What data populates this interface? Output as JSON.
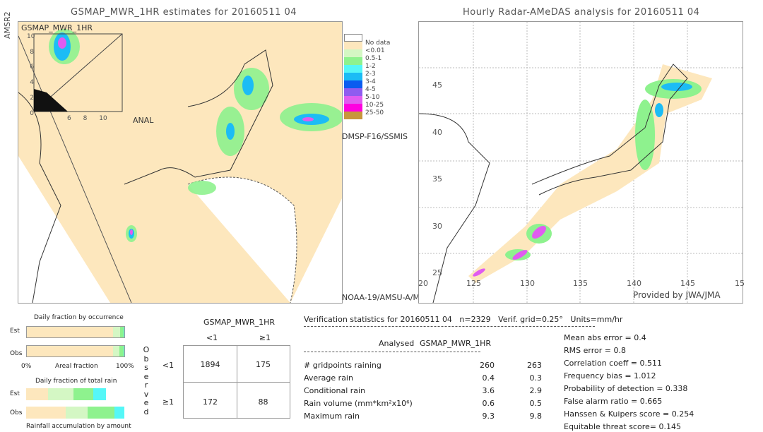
{
  "left_map": {
    "title": "GSMAP_MWR_1HR estimates for 20160511 04",
    "sensor_top": "AMSR2",
    "inset_label": "GSMAP_MWR_1HR",
    "inset_ticks": [
      "0",
      "2",
      "4",
      "6",
      "8",
      "10"
    ],
    "anal_label": "ANAL",
    "sensor_mid": "DMSP-F16/SSMIS",
    "sensor_bottom": "NOAA-19/AMSU-A/M"
  },
  "legend": [
    {
      "label": "No data",
      "color": "#ffffff"
    },
    {
      "label": "<0.01",
      "color": "#fde7bd"
    },
    {
      "label": "0.5-1",
      "color": "#d4f7c4"
    },
    {
      "label": "1-2",
      "color": "#8ef28e"
    },
    {
      "label": "2-3",
      "color": "#55f7f7"
    },
    {
      "label": "3-4",
      "color": "#1cbcf5"
    },
    {
      "label": "4-5",
      "color": "#0a5cf0"
    },
    {
      "label": "5-10",
      "color": "#8f5cf0"
    },
    {
      "label": "10-25",
      "color": "#e05cf0"
    },
    {
      "label": "25-50",
      "color": "#ff00e0"
    },
    {
      "label": "",
      "color": "#c8963c"
    }
  ],
  "right_map": {
    "title": "Hourly Radar-AMeDAS analysis for 20160511 04",
    "lat_ticks": [
      "45",
      "40",
      "35",
      "30",
      "25",
      "20"
    ],
    "lon_ticks": [
      "125",
      "130",
      "135",
      "140",
      "145",
      "15"
    ],
    "credit": "Provided by JWA/JMA"
  },
  "occurrence": {
    "title": "Daily fraction by occurrence",
    "est_label": "Est",
    "obs_label": "Obs",
    "axis_left": "0%",
    "axis_mid": "Areal fraction",
    "axis_right": "100%",
    "est_fractions": [
      0.887,
      0.07,
      0.035,
      0.008
    ],
    "obs_fractions": [
      0.887,
      0.06,
      0.045,
      0.008
    ]
  },
  "total_rain": {
    "title": "Daily fraction of total rain",
    "est_label": "Est",
    "obs_label": "Obs",
    "footer": "Rainfall accumulation by amount",
    "est_fractions": [
      0.22,
      0.26,
      0.2,
      0.13
    ],
    "obs_fractions": [
      0.4,
      0.22,
      0.27,
      0.1
    ]
  },
  "contingency": {
    "header": "GSMAP_MWR_1HR",
    "col_labels": [
      "<1",
      "≥1"
    ],
    "row_title": "Observed",
    "row_labels": [
      "<1",
      "≥1"
    ],
    "cells": [
      [
        "1894",
        "175"
      ],
      [
        "172",
        "88"
      ]
    ]
  },
  "stats": {
    "heading": "Verification statistics for 20160511 04   n=2329   Verif. grid=0.25°   Units=mm/hr",
    "col_analysed": "Analysed",
    "col_est": "GSMAP_MWR_1HR",
    "rows": [
      {
        "label": "# gridpoints raining",
        "a": "260",
        "b": "263"
      },
      {
        "label": "Average rain",
        "a": "0.4",
        "b": "0.3"
      },
      {
        "label": "Conditional rain",
        "a": "3.6",
        "b": "2.9"
      },
      {
        "label": "Rain volume (mm*km²x10⁶)",
        "a": "0.6",
        "b": "0.5"
      },
      {
        "label": "Maximum rain",
        "a": "9.3",
        "b": "9.8"
      }
    ],
    "scores": [
      "Mean abs error = 0.4",
      "RMS error = 0.8",
      "Correlation coeff = 0.511",
      "Frequency bias = 1.012",
      "Probability of detection = 0.338",
      "False alarm ratio = 0.665",
      "Hanssen & Kuipers score = 0.254",
      "Equitable threat score= 0.145"
    ]
  }
}
